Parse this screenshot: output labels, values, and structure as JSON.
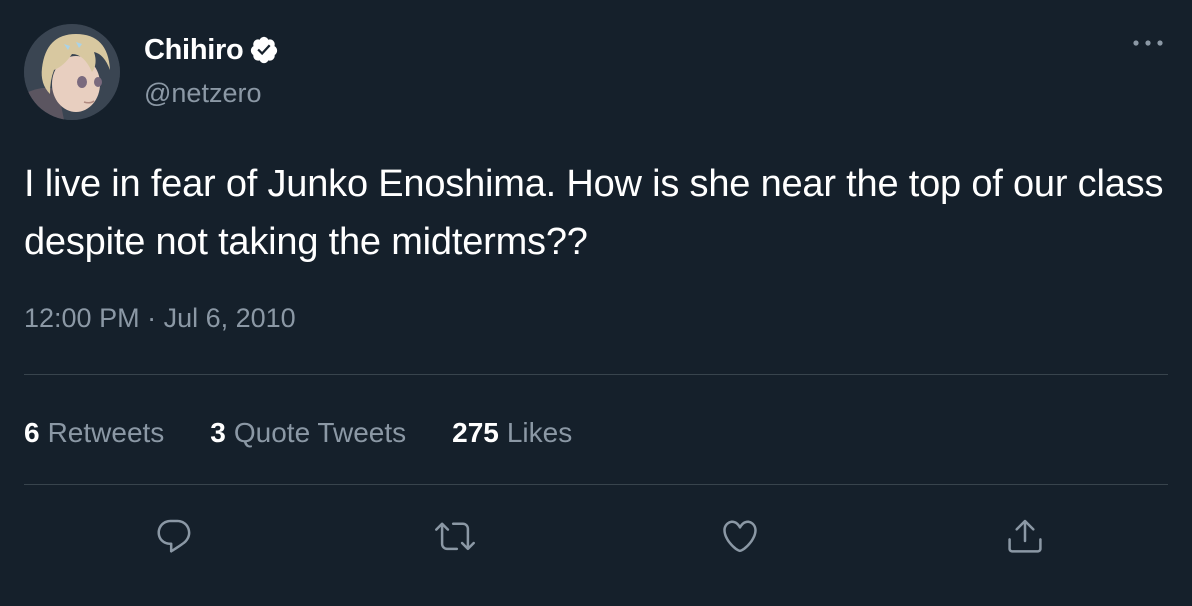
{
  "user": {
    "display_name": "Chihiro",
    "handle": "@netzero",
    "verified": true
  },
  "tweet": {
    "text": "I live in fear of Junko Enoshima. How is she near the top of our class despite not taking the midterms??",
    "time": "12:00 PM",
    "separator": " · ",
    "date": "Jul 6, 2010"
  },
  "stats": [
    {
      "count": "6",
      "label": "Retweets"
    },
    {
      "count": "3",
      "label": "Quote Tweets"
    },
    {
      "count": "275",
      "label": "Likes"
    }
  ],
  "actions": [
    "reply-icon",
    "retweet-icon",
    "like-icon",
    "share-icon"
  ],
  "colors": {
    "background": "#15202b",
    "text_primary": "#ffffff",
    "text_secondary": "#8b98a5",
    "divider": "#38444d",
    "icon": "#8b98a5"
  }
}
